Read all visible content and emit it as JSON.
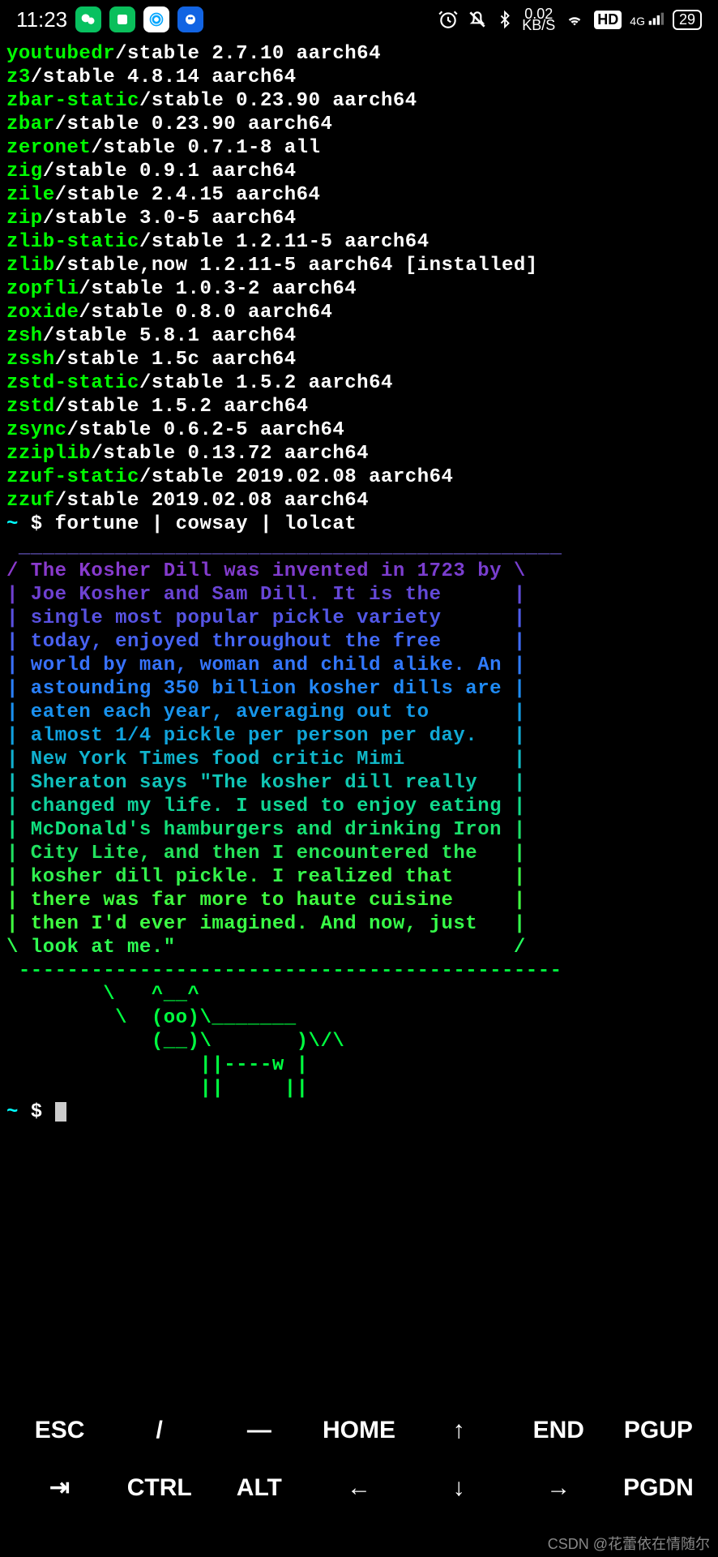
{
  "status": {
    "time": "11:23",
    "net_speed_top": "0.02",
    "net_speed_bottom": "KB/S",
    "hd": "HD",
    "net_gen": "4G",
    "battery": "29"
  },
  "packages": [
    {
      "name": "youtubedr",
      "rest": "/stable 2.7.10 aarch64"
    },
    {
      "name": "z3",
      "rest": "/stable 4.8.14 aarch64"
    },
    {
      "name": "zbar-static",
      "rest": "/stable 0.23.90 aarch64"
    },
    {
      "name": "zbar",
      "rest": "/stable 0.23.90 aarch64"
    },
    {
      "name": "zeronet",
      "rest": "/stable 0.7.1-8 all"
    },
    {
      "name": "zig",
      "rest": "/stable 0.9.1 aarch64"
    },
    {
      "name": "zile",
      "rest": "/stable 2.4.15 aarch64"
    },
    {
      "name": "zip",
      "rest": "/stable 3.0-5 aarch64"
    },
    {
      "name": "zlib-static",
      "rest": "/stable 1.2.11-5 aarch64"
    },
    {
      "name": "zlib",
      "rest": "/stable,now 1.2.11-5 aarch64 [installed]"
    },
    {
      "name": "zopfli",
      "rest": "/stable 1.0.3-2 aarch64"
    },
    {
      "name": "zoxide",
      "rest": "/stable 0.8.0 aarch64"
    },
    {
      "name": "zsh",
      "rest": "/stable 5.8.1 aarch64"
    },
    {
      "name": "zssh",
      "rest": "/stable 1.5c aarch64"
    },
    {
      "name": "zstd-static",
      "rest": "/stable 1.5.2 aarch64"
    },
    {
      "name": "zstd",
      "rest": "/stable 1.5.2 aarch64"
    },
    {
      "name": "zsync",
      "rest": "/stable 0.6.2-5 aarch64"
    },
    {
      "name": "zziplib",
      "rest": "/stable 0.13.72 aarch64"
    },
    {
      "name": "zzuf-static",
      "rest": "/stable 2019.02.08 aarch64"
    },
    {
      "name": "zzuf",
      "rest": "/stable 2019.02.08 aarch64"
    }
  ],
  "prompt1": {
    "tilde": "~",
    "dollar": " $ ",
    "cmd": "fortune | cowsay | lolcat"
  },
  "bubble_top": " _____________________________________________",
  "lolcat": [
    {
      "l": "/ ",
      "t": "The Kosher Dill was invented in 1723 by",
      "r": " \\",
      "c1": "#8b3acd",
      "c2": "#7040d0"
    },
    {
      "l": "| ",
      "t": "Joe Kosher and Sam Dill. It is the     ",
      "r": " |",
      "c1": "#7040d0",
      "c2": "#5a50e0"
    },
    {
      "l": "| ",
      "t": "single most popular pickle variety     ",
      "r": " |",
      "c1": "#5a50e0",
      "c2": "#4a60f0"
    },
    {
      "l": "| ",
      "t": "today, enjoyed throughout the free     ",
      "r": " |",
      "c1": "#4a60f0",
      "c2": "#3a70ff"
    },
    {
      "l": "| ",
      "t": "world by man, woman and child alike. An",
      "r": " |",
      "c1": "#3a70ff",
      "c2": "#2a80ff"
    },
    {
      "l": "| ",
      "t": "astounding 350 billion kosher dills are",
      "r": " |",
      "c1": "#2a80ff",
      "c2": "#1a90f0"
    },
    {
      "l": "| ",
      "t": "eaten each year, averaging out to      ",
      "r": " |",
      "c1": "#1a90f0",
      "c2": "#10a0e0"
    },
    {
      "l": "| ",
      "t": "almost 1/4 pickle per person per day.  ",
      "r": " |",
      "c1": "#10a0e0",
      "c2": "#10b0d0"
    },
    {
      "l": "| ",
      "t": "New York Times food critic Mimi        ",
      "r": " |",
      "c1": "#10b0d0",
      "c2": "#10c0c0"
    },
    {
      "l": "| ",
      "t": "Sheraton says \"The kosher dill really  ",
      "r": " |",
      "c1": "#10c0c0",
      "c2": "#10d0a0"
    },
    {
      "l": "| ",
      "t": "changed my life. I used to enjoy eating",
      "r": " |",
      "c1": "#10d0a0",
      "c2": "#10e080"
    },
    {
      "l": "| ",
      "t": "McDonald's hamburgers and drinking Iron",
      "r": " |",
      "c1": "#10e080",
      "c2": "#20e060"
    },
    {
      "l": "| ",
      "t": "City Lite, and then I encountered the  ",
      "r": " |",
      "c1": "#20e060",
      "c2": "#30f050"
    },
    {
      "l": "| ",
      "t": "kosher dill pickle. I realized that    ",
      "r": " |",
      "c1": "#30f050",
      "c2": "#40ff40"
    },
    {
      "l": "| ",
      "t": "there was far more to haute cuisine    ",
      "r": " |",
      "c1": "#40ff40",
      "c2": "#40ff40"
    },
    {
      "l": "| ",
      "t": "then I'd ever imagined. And now, just  ",
      "r": " |",
      "c1": "#40ff40",
      "c2": "#30ff50"
    },
    {
      "l": "\\ ",
      "t": "look at me.\"                           ",
      "r": " /",
      "c1": "#30ff50",
      "c2": "#20ff60"
    }
  ],
  "bubble_bottom": " ---------------------------------------------",
  "cow": [
    "        \\   ^__^",
    "         \\  (oo)\\_______",
    "            (__)\\       )\\/\\",
    "                ||----w |",
    "                ||     ||"
  ],
  "prompt2": {
    "tilde": "~",
    "dollar": " $ "
  },
  "keyboard": {
    "row1": [
      "ESC",
      "/",
      "―",
      "HOME",
      "↑",
      "END",
      "PGUP"
    ],
    "row2": [
      "⇥",
      "CTRL",
      "ALT",
      "←",
      "↓",
      "→",
      "PGDN"
    ]
  },
  "watermark": "CSDN @花蕾依在情随尔"
}
